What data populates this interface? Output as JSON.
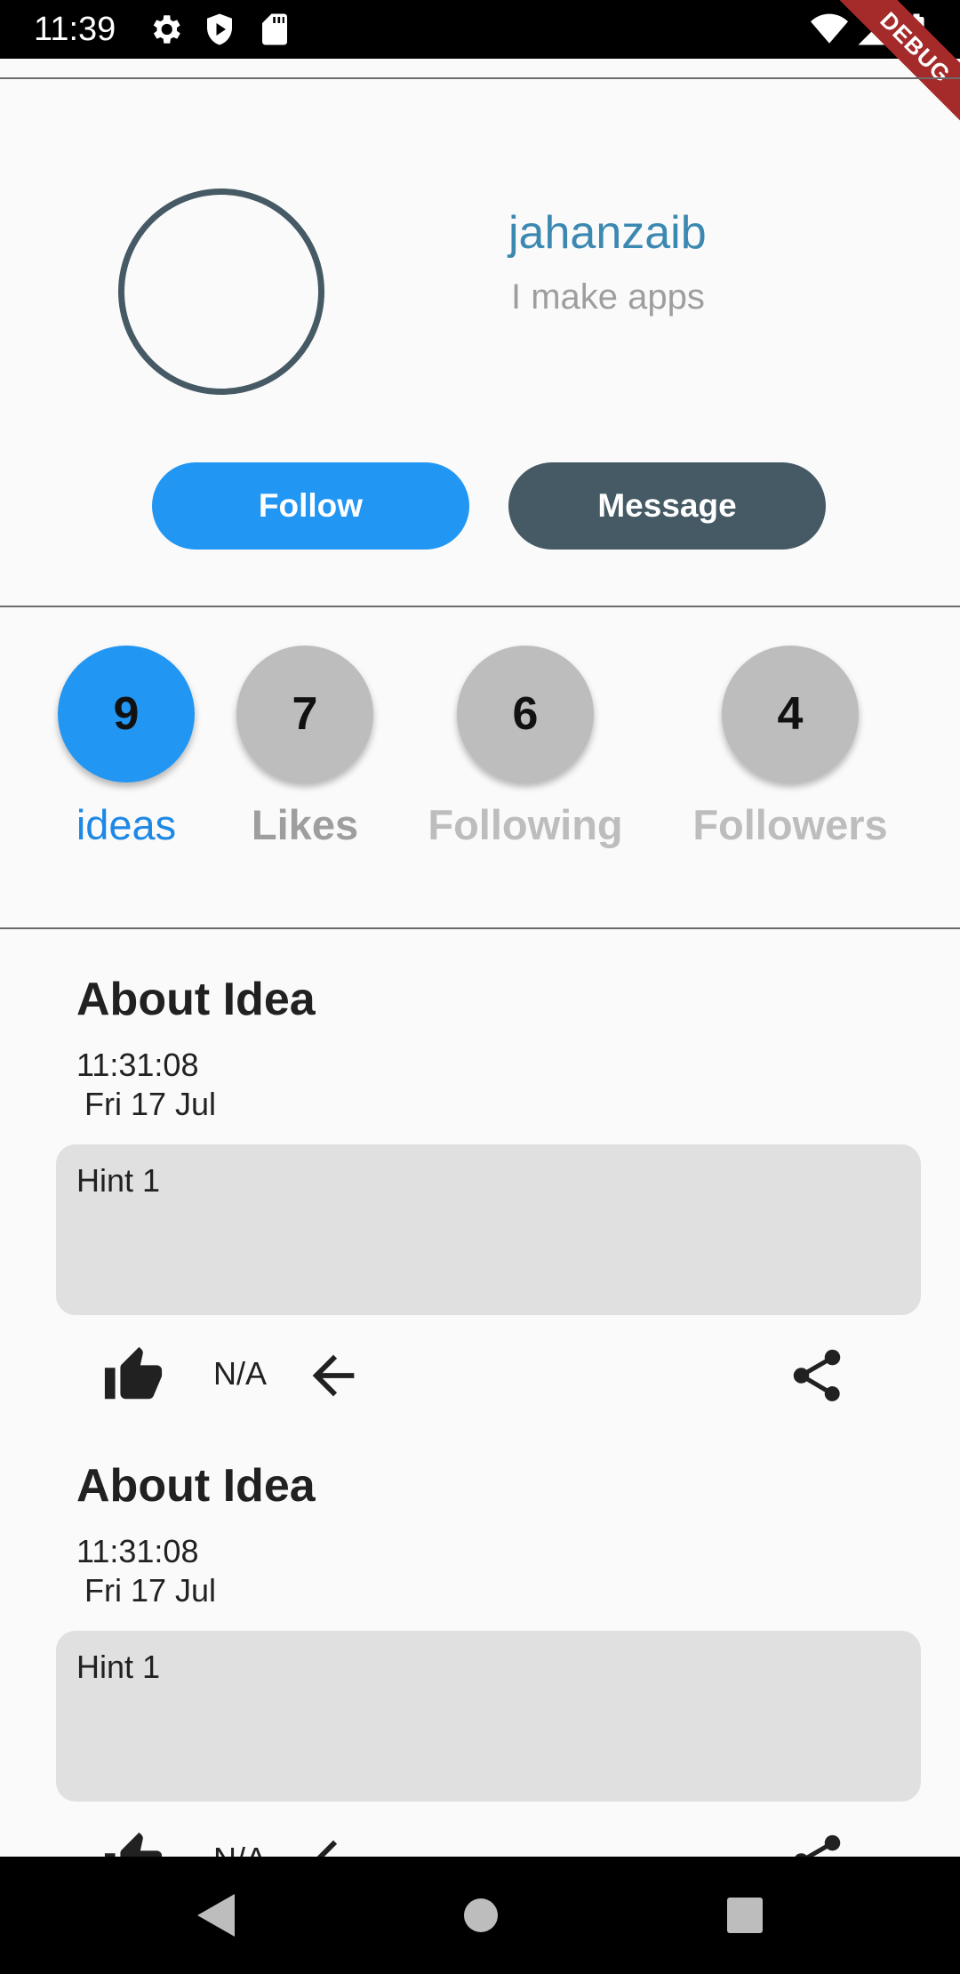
{
  "status_bar": {
    "time": "11:39",
    "icons": [
      "gear-icon",
      "shield-play-icon",
      "sd-card-icon",
      "wifi-icon",
      "signal-icon",
      "battery-icon"
    ],
    "debug_banner": "DEBUG"
  },
  "profile": {
    "name": "jahanzaib",
    "bio": "I make apps",
    "follow_label": "Follow",
    "message_label": "Message"
  },
  "stats": [
    {
      "count": "9",
      "label": "ideas"
    },
    {
      "count": "7",
      "label": "Likes"
    },
    {
      "count": "6",
      "label": "Following"
    },
    {
      "count": "4",
      "label": "Followers"
    }
  ],
  "ideas": [
    {
      "title": "About Idea",
      "time": "11:31:08",
      "date": "Fri 17 Jul",
      "hint": "Hint 1",
      "likes": "N/A"
    },
    {
      "title": "About Idea",
      "time": "11:31:08",
      "date": "Fri 17 Jul",
      "hint": "Hint 1",
      "likes": "N/A"
    }
  ],
  "colors": {
    "accent": "#2196f3",
    "dark": "#455a64",
    "name": "#3b88b0",
    "inactive": "#bdbdbd"
  }
}
